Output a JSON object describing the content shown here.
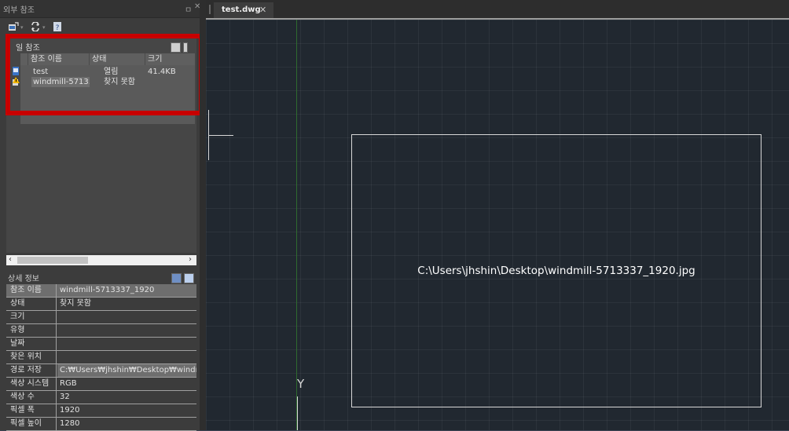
{
  "palette": {
    "title": "외부 참조",
    "pin": "ㅁ",
    "close": "✕"
  },
  "files": {
    "section_title": "일 참조",
    "columns": [
      "참조 이름",
      "상태",
      "크기"
    ],
    "rows": [
      {
        "name": "test",
        "status": "열림",
        "size": "41.4KB"
      },
      {
        "name": "windmill-5713...",
        "status": "찾지 못함",
        "size": ""
      }
    ]
  },
  "details": {
    "title": "상세 정보",
    "rows": [
      {
        "label": "참조 이름",
        "value": "windmill-5713337_1920"
      },
      {
        "label": "상태",
        "value": "찾지 못함"
      },
      {
        "label": "크기",
        "value": ""
      },
      {
        "label": "유형",
        "value": ""
      },
      {
        "label": "날짜",
        "value": ""
      },
      {
        "label": "찾은 위치",
        "value": ""
      },
      {
        "label": "경로 저장",
        "value": "C:₩Users₩jhshin₩Desktop₩windmill..."
      },
      {
        "label": "색상 시스템",
        "value": "RGB"
      },
      {
        "label": "색상 수",
        "value": "32"
      },
      {
        "label": "픽셀 폭",
        "value": "1920"
      },
      {
        "label": "픽셀 높이",
        "value": "1280"
      }
    ]
  },
  "tab": {
    "label": "test.dwg",
    "close": "✕"
  },
  "canvas": {
    "image_path": "C:\\Users\\jhshin\\Desktop\\windmill-5713337_1920.jpg",
    "y_axis": "Y"
  },
  "colors": {
    "highlight_border": "#c80000",
    "canvas_bg": "#212830",
    "panel_bg": "#3c3c3c"
  },
  "icons": [
    "attach-icon",
    "refresh-icon",
    "help-icon",
    "list-view-icon",
    "tree-view-icon",
    "image-file-icon",
    "warning-file-icon"
  ]
}
